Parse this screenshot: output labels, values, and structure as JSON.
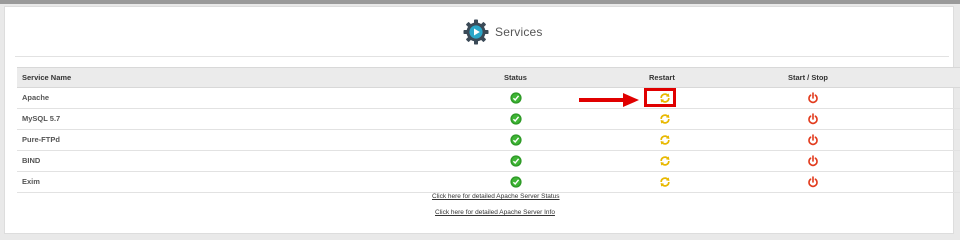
{
  "header": {
    "title": "Services",
    "logo_icon": "services-gear-play-icon"
  },
  "table": {
    "columns": [
      "Service Name",
      "Status",
      "Restart",
      "Start / Stop"
    ],
    "rows": [
      {
        "name": "Apache"
      },
      {
        "name": "MySQL 5.7"
      },
      {
        "name": "Pure-FTPd"
      },
      {
        "name": "BIND"
      },
      {
        "name": "Exim"
      }
    ]
  },
  "links": {
    "apache_status": "Click here for detailed Apache Server Status",
    "apache_info": "Click here for detailed Apache Server Info"
  },
  "colors": {
    "status_ok": "#2e9a27",
    "restart": "#e8b800",
    "power": "#e23a1c",
    "annotation": "#e00000"
  }
}
